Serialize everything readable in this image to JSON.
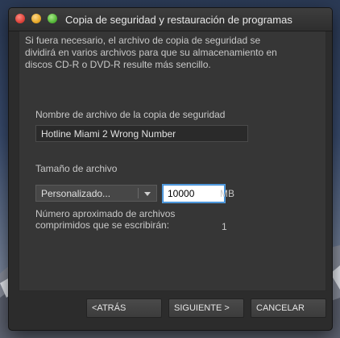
{
  "window": {
    "title": "Copia de seguridad y restauración de programas"
  },
  "description": "Si fuera necesario, el archivo de copia de seguridad se dividirá en varios archivos para que su almacenamiento en discos CD-R o DVD-R resulte más sencillo.",
  "filename": {
    "label": "Nombre de archivo de la copia de seguridad",
    "value": "Hotline Miami 2 Wrong Number"
  },
  "filesize": {
    "label": "Tamaño de archivo",
    "preset": "Personalizado...",
    "value": "10000",
    "unit": "MB"
  },
  "file_count": {
    "label": "Número aproximado de archivos comprimidos que se escribirán:",
    "value": "1"
  },
  "buttons": {
    "back": "<ATRÁS",
    "next": "SIGUIENTE >",
    "cancel": "CANCELAR"
  }
}
